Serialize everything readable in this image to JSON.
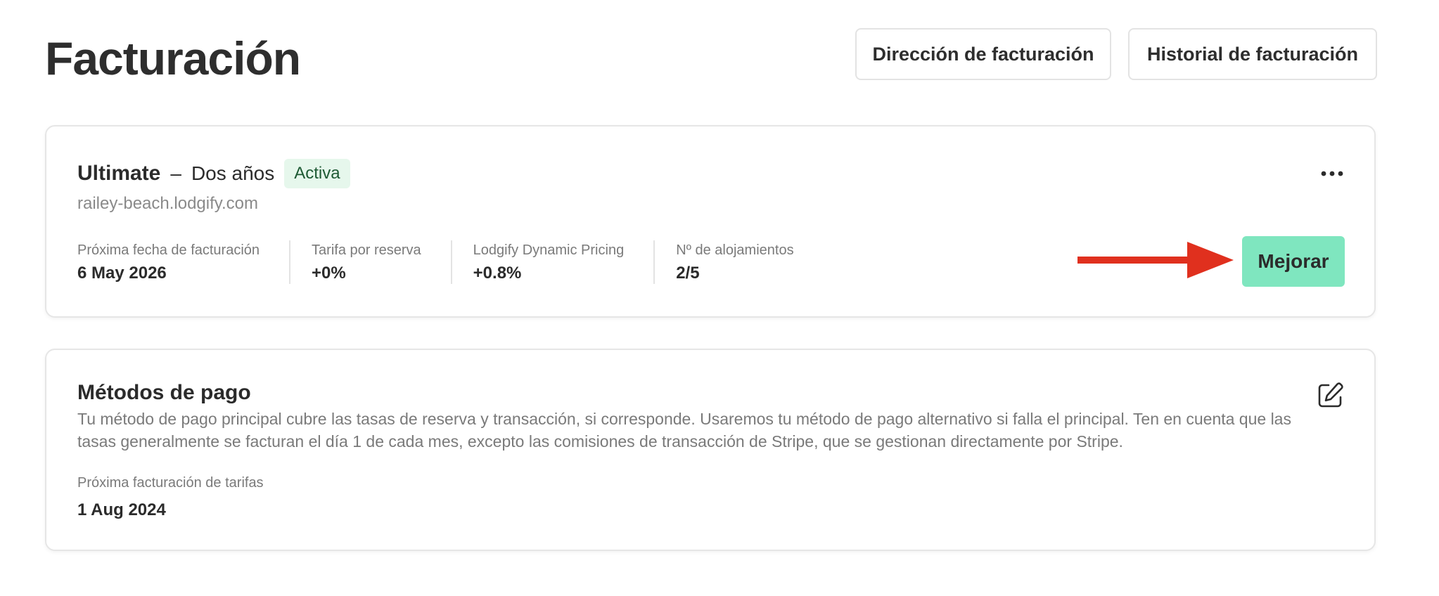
{
  "page": {
    "title": "Facturación"
  },
  "header": {
    "address_button": "Dirección de facturación",
    "history_button": "Historial de facturación"
  },
  "plan": {
    "name": "Ultimate",
    "separator": "–",
    "term": "Dos años",
    "status": "Activa",
    "domain": "railey-beach.lodgify.com",
    "more_icon": "more-horizontal-icon",
    "stats": [
      {
        "label": "Próxima fecha de facturación",
        "value": "6 May 2026"
      },
      {
        "label": "Tarifa por reserva",
        "value": "+0%"
      },
      {
        "label": "Lodgify Dynamic Pricing",
        "value": "+0.8%"
      },
      {
        "label": "Nº de alojamientos",
        "value": "2/5"
      }
    ],
    "upgrade_button": "Mejorar"
  },
  "payment": {
    "title": "Métodos de pago",
    "description": "Tu método de pago principal cubre las tasas de reserva y transacción, si corresponde. Usaremos tu método de pago alternativo si falla el principal. Ten en cuenta que las tasas generalmente se facturan el día 1 de cada mes, excepto las comisiones de transacción de Stripe, que se gestionan directamente por Stripe.",
    "next_label": "Próxima facturación de tarifas",
    "next_value": "1 Aug 2024",
    "edit_icon": "edit-icon"
  },
  "colors": {
    "accent": "#7fe6bf",
    "badge_bg": "#e6f7ec",
    "arrow": "#e0301e"
  }
}
